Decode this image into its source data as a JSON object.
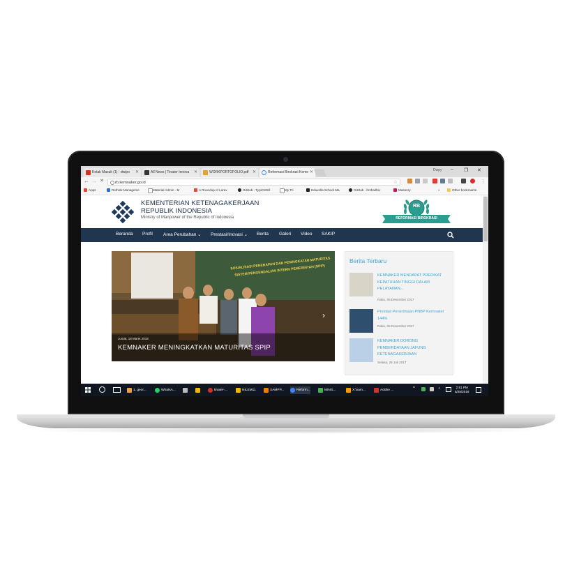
{
  "browser": {
    "tabs": [
      {
        "label": "Kotak Masuk (1) - dwipo",
        "icon": "gmail-icon",
        "color": "#d93025"
      },
      {
        "label": "All News | Tinater Innova",
        "icon": "tinater-icon",
        "color": "#333333"
      },
      {
        "label": "WORKPORTOFOLIO.pdf",
        "icon": "pdf-icon",
        "color": "#e0a52a"
      },
      {
        "label": "Reformasi Birokrasi Keme",
        "icon": "loading-icon",
        "color": "#4285f4"
      }
    ],
    "profile_name": "Dwpy",
    "address": "rb.kemnaker.go.id",
    "bookmarks": [
      {
        "label": "Apps",
        "color": "#e94235"
      },
      {
        "label": "Rethink Manageme",
        "color": "#2a6dd6"
      },
      {
        "label": "Material Admin - M",
        "color": "#888888"
      },
      {
        "label": "A Roundup of Larav",
        "color": "#e04a3a"
      },
      {
        "label": "GitHub - TypiCMS/l",
        "color": "#222222"
      },
      {
        "label": "My Tri",
        "color": "#888888"
      },
      {
        "label": "Eduvella School Ma",
        "color": "#222222"
      },
      {
        "label": "GitHub - hrshadhiv",
        "color": "#222222"
      },
      {
        "label": "Masonry",
        "color": "#c2185b"
      }
    ],
    "other_bookmarks": "Other bookmarks"
  },
  "site": {
    "title_line1": "KEMENTERIAN KETENAGAKERJAAN",
    "title_line2": "REPUBLIK INDONESIA",
    "subtitle": "Ministry of Manpower of the Republic of Indonesia",
    "badge_initials": "RB",
    "badge_text": "REFORMASI BIROKRASI",
    "nav": [
      "Beranda",
      "Profil",
      "Area Perubahan ⌄",
      "Prestasi/Inovasi ⌄",
      "Berita",
      "Galeri",
      "Video",
      "SAKIP"
    ]
  },
  "slider": {
    "date": "Jumat, 16 Maret 2018",
    "title": "KEMNAKER MENINGKATKAN MATURITAS SPIP",
    "banner_line1": "SOSIALISASI PENERAPAN DAN PENINGKATAN MATURITAS",
    "banner_line2": "SISTEM PENGENDALIAN INTERN PEMERINTAH (SPIP)"
  },
  "sidebar": {
    "title": "Berita Terbaru",
    "news": [
      {
        "title": "KEMNAKER MENDAPAT PREDIKAT KEPATUHAN TINGGI DALAM PELAYANAN...",
        "date": "Rabu, 06 Desember 2017"
      },
      {
        "title": "Prestasi Penerimaan PNBP Kemnaker 144%",
        "date": "Rabu, 06 Desember 2017"
      },
      {
        "title": "KEMNAKER DORONG PEMBERDAYAAN JAFUNG KETENAGAKERJAAN",
        "date": "Selasa, 25 Juli 2017"
      }
    ]
  },
  "taskbar": {
    "items": [
      {
        "label": "1. geor...",
        "color": "#e8a33a"
      },
      {
        "label": "WhatsA...",
        "color": "#25d366"
      },
      {
        "label": "",
        "color": "#bbbbbb"
      },
      {
        "label": "",
        "color": "#f2b705"
      },
      {
        "label": "tinater-...",
        "color": "#d93025"
      },
      {
        "label": "NILEM11",
        "color": "#f2b705"
      },
      {
        "label": "XAMPP...",
        "color": "#f57c00"
      },
      {
        "label": "Reform...",
        "color": "#4285f4"
      },
      {
        "label": "MING...",
        "color": "#4caf50"
      },
      {
        "label": "X:\\xam...",
        "color": "#ff9800"
      },
      {
        "label": "Adobe ...",
        "color": "#d32f2f"
      }
    ],
    "time": "2:51 PM",
    "date": "5/25/2018"
  },
  "colors": {
    "navbar": "#20364f",
    "accent": "#3fa3d8",
    "badge_green": "#2a9d8f"
  }
}
